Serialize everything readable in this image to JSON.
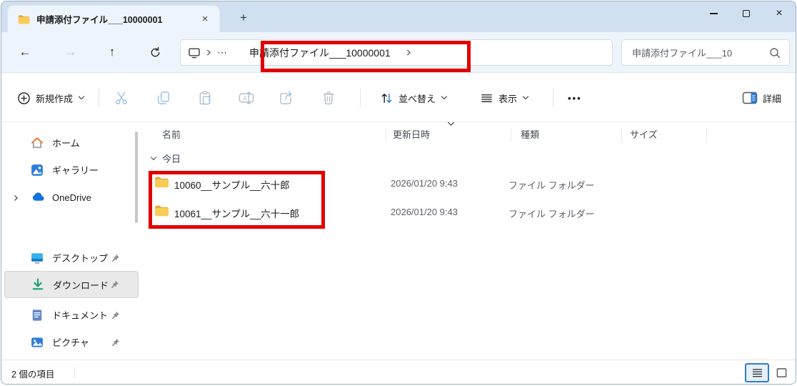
{
  "tab": {
    "title": "申請添付ファイル___10000001"
  },
  "icons": {
    "tab_close": "×",
    "new_tab": "+",
    "window_close": "×",
    "back": "←",
    "forward": "→",
    "up": "↑",
    "breadcrumb_overflow": "⋯",
    "toolbar_more": "•••"
  },
  "nav": {
    "breadcrumb": {
      "current": "申請添付ファイル___10000001"
    },
    "search_value": "申請添付ファイル___10"
  },
  "toolbar": {
    "new_label": "新規作成",
    "sort_label": "並べ替え",
    "view_label": "表示",
    "details_label": "詳細"
  },
  "sidebar": {
    "items": [
      {
        "label": "ホーム",
        "icon": "home",
        "pinned": false
      },
      {
        "label": "ギャラリー",
        "icon": "gallery",
        "pinned": false
      },
      {
        "label": "OneDrive",
        "icon": "onedrive-cloud",
        "pinned": false,
        "expandable": true
      },
      {
        "label": "デスクトップ",
        "icon": "desktop",
        "pinned": true
      },
      {
        "label": "ダウンロード",
        "icon": "downloads",
        "pinned": true,
        "selected": true
      },
      {
        "label": "ドキュメント",
        "icon": "documents",
        "pinned": true
      },
      {
        "label": "ピクチャ",
        "icon": "pictures",
        "pinned": true
      }
    ]
  },
  "filelist": {
    "columns": [
      "名前",
      "更新日時",
      "種類",
      "サイズ"
    ],
    "group_label": "今日",
    "rows": [
      {
        "name": "10060__サンプル__六十郎",
        "date": "2026/01/20 9:43",
        "type": "ファイル フォルダー",
        "size": ""
      },
      {
        "name": "10061__サンプル__六十一郎",
        "date": "2026/01/20 9:43",
        "type": "ファイル フォルダー",
        "size": ""
      }
    ]
  },
  "statusbar": {
    "count": "2 個の項目"
  },
  "colors": {
    "annotation": "#e10000",
    "accent": "#2a7cd4",
    "titlebar": "#d0e0f1"
  }
}
